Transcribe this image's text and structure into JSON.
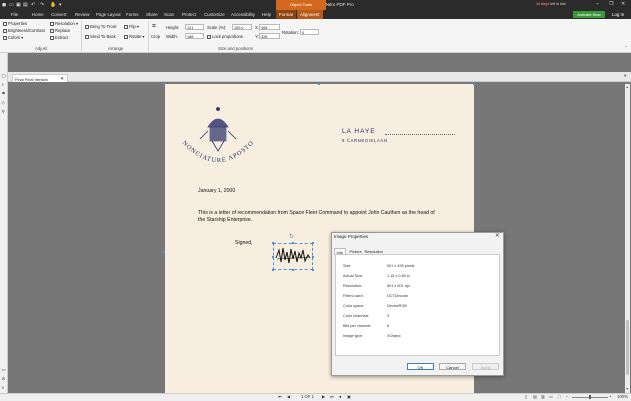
{
  "window": {
    "title": "Final Final Version.pdf - Nitro PDF Pro",
    "context_tab": "Object Tools",
    "trial_prefix": "14 days",
    "trial_suffix": "left in trial"
  },
  "menus": [
    "File",
    "Home",
    "Convert",
    "Review",
    "Page Layout",
    "Forms",
    "Share",
    "Scan",
    "Protect",
    "Customize",
    "Accessibility",
    "Help"
  ],
  "context_menus": [
    "Format",
    "Alignment"
  ],
  "activate_label": "Activate Now",
  "login_label": "Log In",
  "ribbon": {
    "adjust": {
      "label": "Adjust",
      "properties": "Properties",
      "brightness": "Brightness/Contrast",
      "colors": "Colors",
      "resolution": "Resolution",
      "replace": "Replace",
      "extract": "Extract"
    },
    "arrange": {
      "label": "Arrange",
      "bring_front": "Bring To Front",
      "send_back": "Send To Back",
      "flip": "Flip",
      "rotate": "Rotate"
    },
    "size": {
      "label": "Size and positions",
      "crop": "Crop",
      "height_label": "Height:",
      "height_val": "121",
      "width_label": "Width:",
      "width_val": "168",
      "scale_label": "Scale (%):",
      "scale_val": "100.0",
      "lock_label": "Lock proportions",
      "x_label": "X:",
      "x_val": "408",
      "y_label": "Y:",
      "y_val": "328",
      "rotation_label": "Rotation:",
      "rotation_val": "0"
    }
  },
  "doc_tab": "Final Final Version",
  "document": {
    "place": "LA HAYE",
    "address": "8 CARNEGIELAAN",
    "date": "January 1, 2000",
    "body": "This is a letter of recommendation from Space Fleet Command to appoint John Cauthen as the head of the Starship Enterprise.",
    "signed": "Signed,"
  },
  "dialog": {
    "title": "Image Properties",
    "tabs": [
      "Info",
      "Picture",
      "Resolution"
    ],
    "rows": [
      {
        "label": "Size:",
        "value": "601 x 495 pixels"
      },
      {
        "label": "Actual Size:",
        "value": "1.15 x 0.83 in"
      },
      {
        "label": "Resolution:",
        "value": "601 x 601 dpi"
      },
      {
        "label": "Filters used:",
        "value": "DCTDecode"
      },
      {
        "label": "Color space:",
        "value": "DeviceRGB"
      },
      {
        "label": "Color channels:",
        "value": "3"
      },
      {
        "label": "Bits per channel:",
        "value": "8"
      },
      {
        "label": "Image type:",
        "value": "XObject"
      }
    ],
    "ok": "OK",
    "cancel": "Cancel",
    "apply": "Apply"
  },
  "status": {
    "page": "1 OF 1",
    "zoom": "100%"
  },
  "colors": {
    "accent": "#d2691e",
    "titlebar": "#2b2b2b",
    "paper": "#f7eedf",
    "selection": "#4a90d9"
  }
}
